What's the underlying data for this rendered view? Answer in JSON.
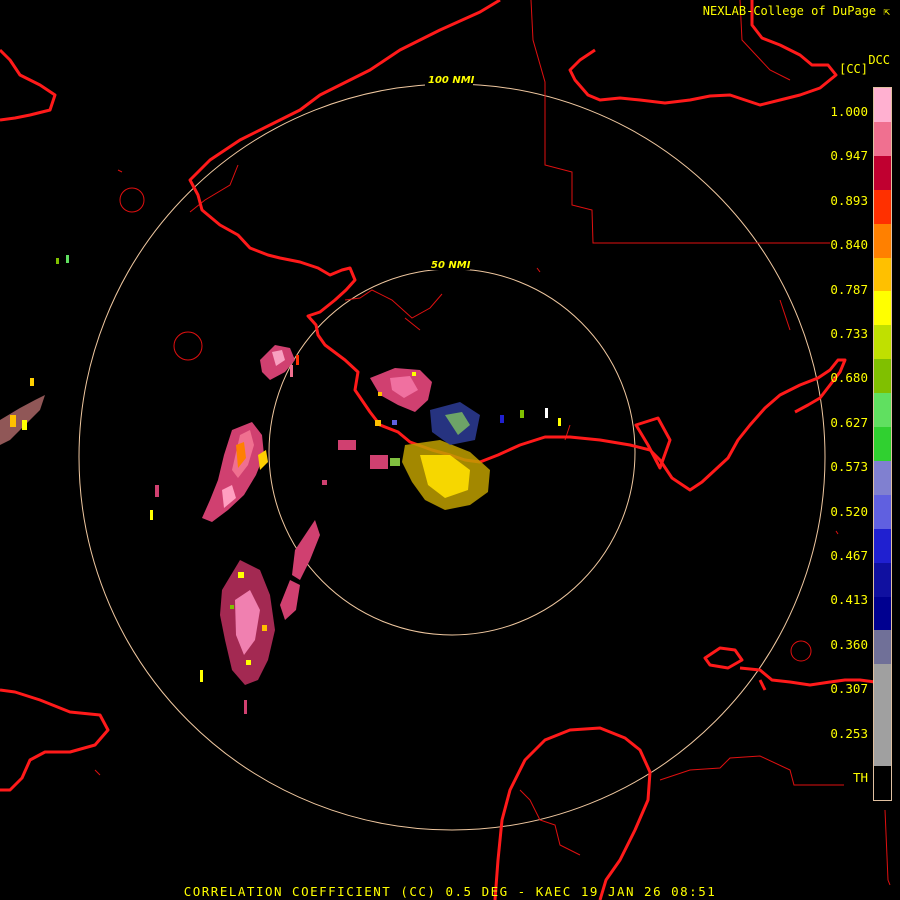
{
  "header": {
    "credit": "NEXLAB-College of DuPage",
    "credit_icon": "cursor-arrow-icon",
    "product_code": "DCC",
    "unit": "[CC]"
  },
  "rings": [
    {
      "label": "100 NMI"
    },
    {
      "label": "50 NMI"
    }
  ],
  "colorbar": {
    "ticks": [
      "1.000",
      "0.947",
      "0.893",
      "0.840",
      "0.787",
      "0.733",
      "0.680",
      "0.627",
      "0.573",
      "0.520",
      "0.467",
      "0.413",
      "0.360",
      "0.307",
      "0.253",
      "TH"
    ],
    "colors": [
      "#ffb0d0",
      "#f07090",
      "#c00030",
      "#ff3000",
      "#ff8000",
      "#ffc000",
      "#ffff00",
      "#c0e000",
      "#80c000",
      "#60e060",
      "#30d030",
      "#8080d0",
      "#6060e0",
      "#2020d0",
      "#1010a0",
      "#000090",
      "#707098",
      "#a0a0a0",
      "#a0a0a0",
      "#a0a0a0",
      "#000000"
    ]
  },
  "footer": "CORRELATION COEFFICIENT (CC) 0.5 DEG - KAEC 19 JAN 26 08:51",
  "theme": {
    "background": "#000000",
    "border_color": "#ff1a1a",
    "county_color": "#e01010",
    "ring_color": "#f0c8a0",
    "text_color": "#ffff00"
  }
}
